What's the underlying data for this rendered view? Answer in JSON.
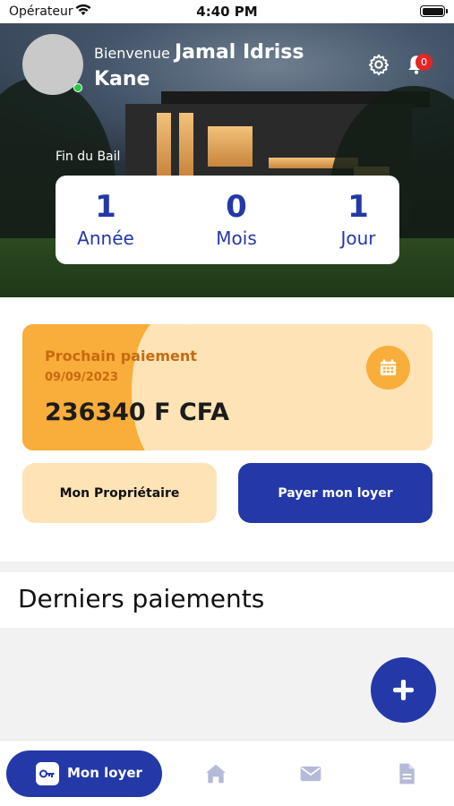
{
  "status_bar": {
    "carrier": "Opérateur",
    "time": "4:40 PM"
  },
  "header": {
    "welcome": "Bienvenue",
    "user_name_line1": "Jamal Idriss",
    "user_name_line2": "Kane",
    "notifications_count": "0",
    "online": true
  },
  "lease": {
    "label": "Fin du Bail",
    "countdown": [
      {
        "value": "1",
        "unit": "Année"
      },
      {
        "value": "0",
        "unit": "Mois"
      },
      {
        "value": "1",
        "unit": "Jour"
      }
    ]
  },
  "next_payment": {
    "title": "Prochain paiement",
    "date": "09/09/2023",
    "amount": "236340 F CFA"
  },
  "actions": {
    "owner_label": "Mon Propriétaire",
    "pay_label": "Payer mon loyer"
  },
  "recent_payments": {
    "title": "Derniers paiements",
    "items": []
  },
  "bottom_nav": {
    "active_label": "Mon loyer",
    "items": [
      "key-icon",
      "home-icon",
      "mail-icon",
      "document-icon"
    ]
  },
  "colors": {
    "primary": "#2438a8",
    "accent_orange": "#f9ad3a",
    "card_peach": "#fde3b6",
    "badge_red": "#e32626"
  }
}
